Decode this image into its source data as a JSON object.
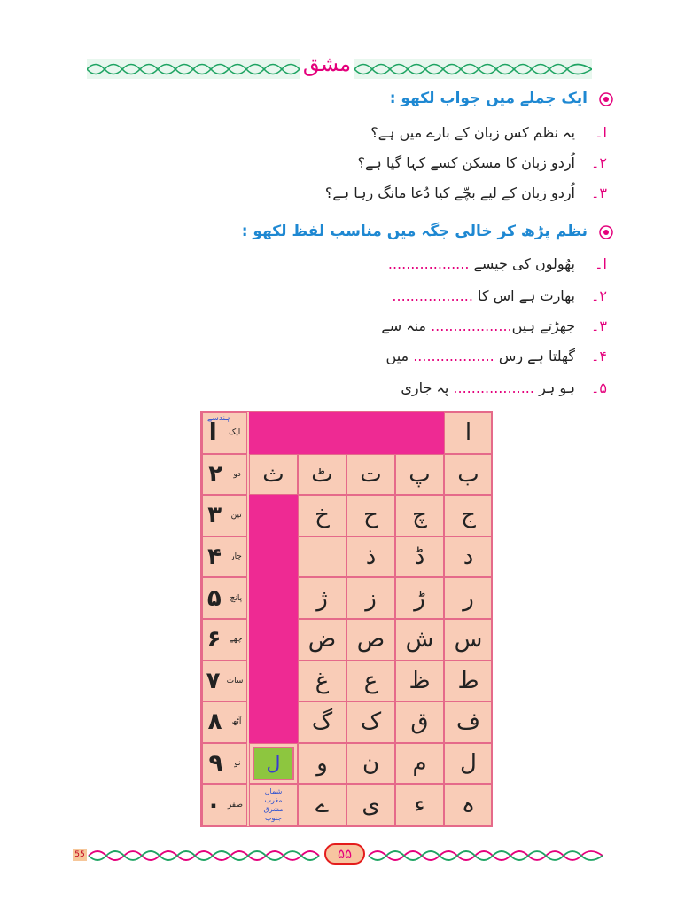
{
  "exercise_title": "مشق",
  "section1": {
    "heading": "ایک جملے میں جواب لکھو :",
    "questions": [
      {
        "num": "ا۔",
        "text": "یہ نظم کس زبان کے بارے میں ہے؟"
      },
      {
        "num": "۲۔",
        "text": "اُردو زبان کا مسکن کسے کہا گیا ہے؟"
      },
      {
        "num": "۳۔",
        "text": "اُردو زبان کے لیے بچّے کیا دُعا مانگ رہا ہے؟"
      }
    ]
  },
  "section2": {
    "heading": "نظم پڑھ کر خالی جگہ میں مناسب لفظ لکھو :",
    "items": [
      {
        "num": "ا۔",
        "before": "پھُولوں کی جیسے",
        "blank": "..................",
        "after": ""
      },
      {
        "num": "۲۔",
        "before": "بھارت ہے اس کا",
        "blank": "..................",
        "after": ""
      },
      {
        "num": "۳۔",
        "before": "جھڑتے ہیں",
        "blank": "..................",
        "after": "منہ سے"
      },
      {
        "num": "۴۔",
        "before": "گھلتا ہے رس",
        "blank": "..................",
        "after": "میں"
      },
      {
        "num": "۵۔",
        "before": "ہو ہر",
        "blank": "..................",
        "after": "پہ جاری"
      }
    ]
  },
  "grid": {
    "hindse_label": "ہندسے",
    "numbers": [
      {
        "digit": "ا",
        "word": "ایک"
      },
      {
        "digit": "۲",
        "word": "دو"
      },
      {
        "digit": "۳",
        "word": "تین"
      },
      {
        "digit": "۴",
        "word": "چار"
      },
      {
        "digit": "۵",
        "word": "پانچ"
      },
      {
        "digit": "۶",
        "word": "چھے"
      },
      {
        "digit": "۷",
        "word": "سات"
      },
      {
        "digit": "۸",
        "word": "آٹھ"
      },
      {
        "digit": "۹",
        "word": "نو"
      },
      {
        "digit": "۰",
        "word": "صفر"
      }
    ],
    "rows": [
      [
        "ا",
        "",
        "",
        "",
        ""
      ],
      [
        "ب",
        "پ",
        "ت",
        "ٹ",
        "ث"
      ],
      [
        "ج",
        "چ",
        "ح",
        "خ",
        ""
      ],
      [
        "د",
        "ڈ",
        "ذ",
        "",
        ""
      ],
      [
        "ر",
        "ڑ",
        "ز",
        "ژ",
        ""
      ],
      [
        "س",
        "ش",
        "ص",
        "ض",
        ""
      ],
      [
        "ط",
        "ظ",
        "ع",
        "غ",
        ""
      ],
      [
        "ف",
        "ق",
        "ک",
        "گ",
        ""
      ],
      [
        "ل",
        "م",
        "ن",
        "و",
        ""
      ],
      [
        "ہ",
        "ء",
        "ی",
        "ے",
        ""
      ]
    ],
    "highlight_letter": "ل",
    "compass": [
      "شمال",
      "مغرب",
      "مشرق",
      "جنوب"
    ]
  },
  "page_number": "55",
  "page_number_urdu": "۵۵",
  "colors": {
    "accent_pink": "#e4007c",
    "heading_blue": "#1e88d2",
    "grid_bg": "#f9ccb7",
    "grid_border": "#e56a8a",
    "grid_pink": "#ee2a93",
    "highlight_green": "#8dc63f",
    "band_green": "#1fa463"
  }
}
